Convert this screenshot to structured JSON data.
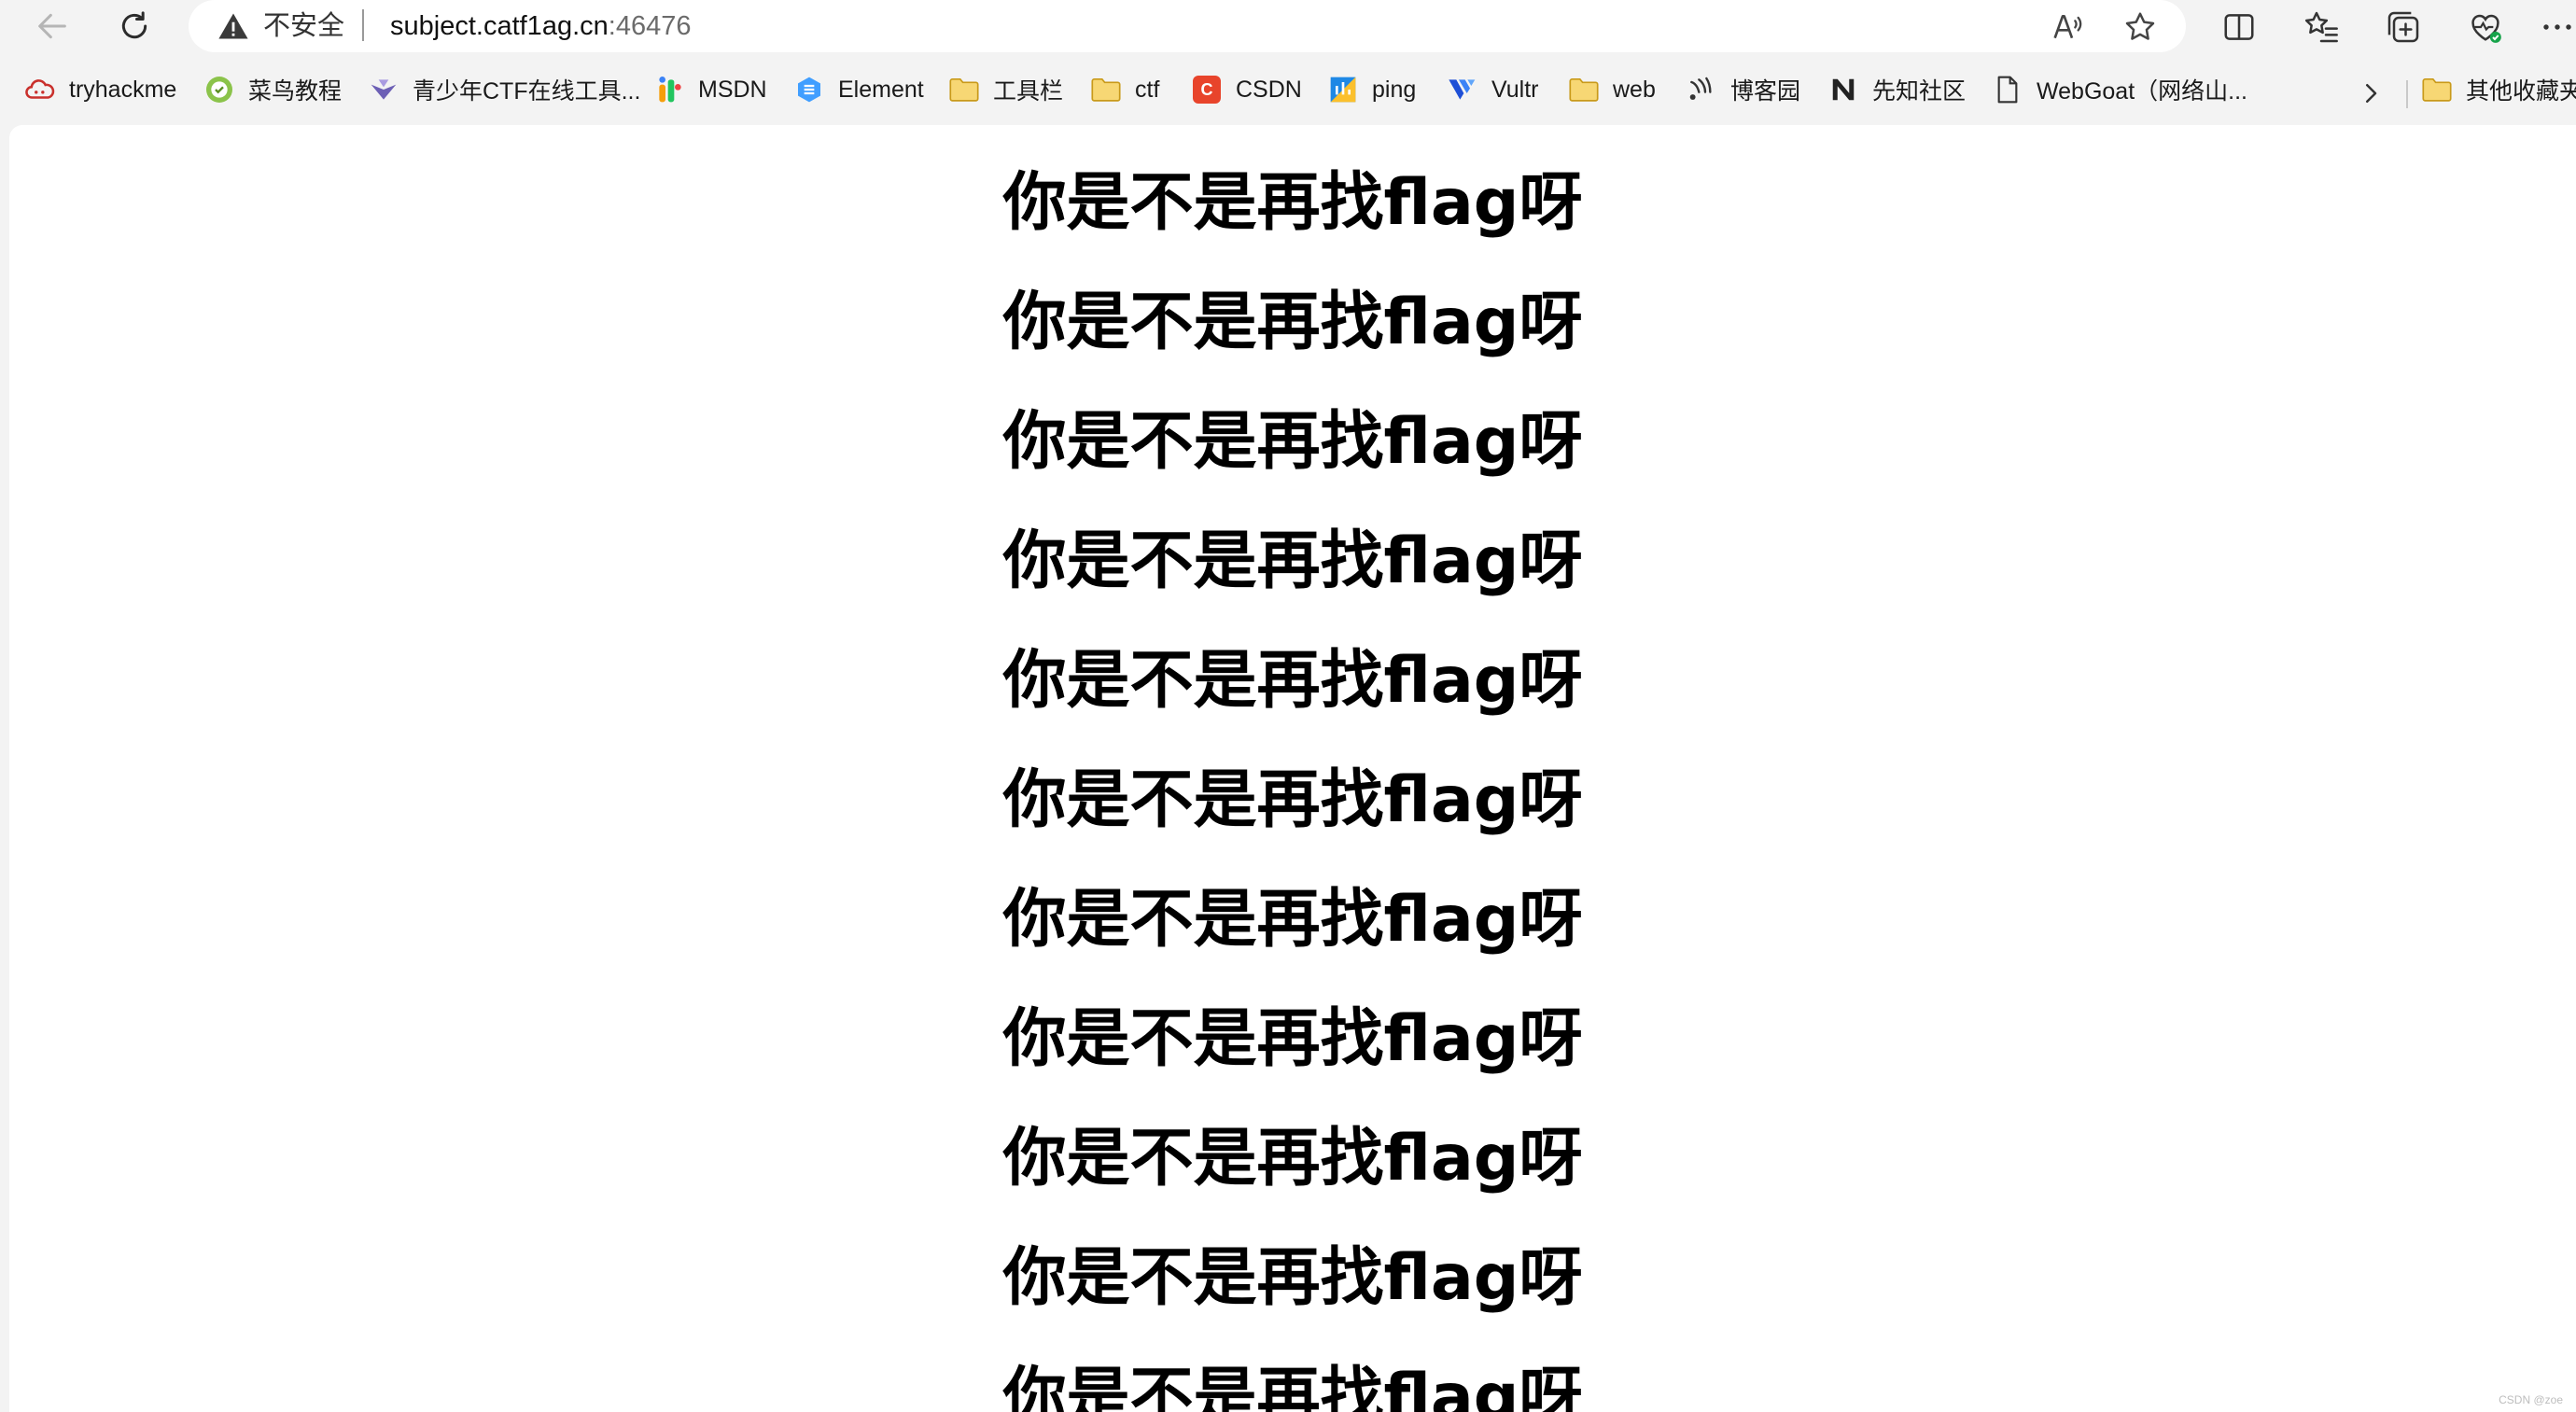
{
  "browser": {
    "address": {
      "security_label": "不安全",
      "host": "subject.catf1ag.cn",
      "port": ":46476"
    }
  },
  "bookmarks": [
    {
      "label": "tryhackme",
      "icon": "tryhackme-cloud-icon"
    },
    {
      "label": "菜鸟教程",
      "icon": "runoob-icon"
    },
    {
      "label": "青少年CTF在线工具...",
      "icon": "qsnctf-icon"
    },
    {
      "label": "MSDN",
      "icon": "msdn-icon"
    },
    {
      "label": "Element",
      "icon": "element-icon"
    },
    {
      "label": "工具栏",
      "icon": "folder-icon"
    },
    {
      "label": "ctf",
      "icon": "folder-icon"
    },
    {
      "label": "CSDN",
      "icon": "csdn-icon"
    },
    {
      "label": "ping",
      "icon": "ping-icon"
    },
    {
      "label": "Vultr",
      "icon": "vultr-icon"
    },
    {
      "label": "web",
      "icon": "folder-icon"
    },
    {
      "label": "博客园",
      "icon": "cnblogs-icon"
    },
    {
      "label": "先知社区",
      "icon": "xianzhi-icon"
    },
    {
      "label": "WebGoat（网络山...",
      "icon": "page-icon"
    },
    {
      "label": "其他收藏夹",
      "icon": "folder-icon"
    }
  ],
  "page": {
    "headings": [
      "你是不是再找flag呀",
      "你是不是再找flag呀",
      "你是不是再找flag呀",
      "你是不是再找flag呀",
      "你是不是再找flag呀",
      "你是不是再找flag呀",
      "你是不是再找flag呀",
      "你是不是再找flag呀",
      "你是不是再找flag呀",
      "你是不是再找flag呀",
      "你是不是再找flag呀"
    ],
    "watermark": "CSDN @zoe"
  },
  "colors": {
    "chrome_bg": "#f3f3f3",
    "page_bg": "#ffffff",
    "folder": "#f2c94c",
    "csdn": "#e8442b",
    "vultr": "#1e4fd6"
  }
}
